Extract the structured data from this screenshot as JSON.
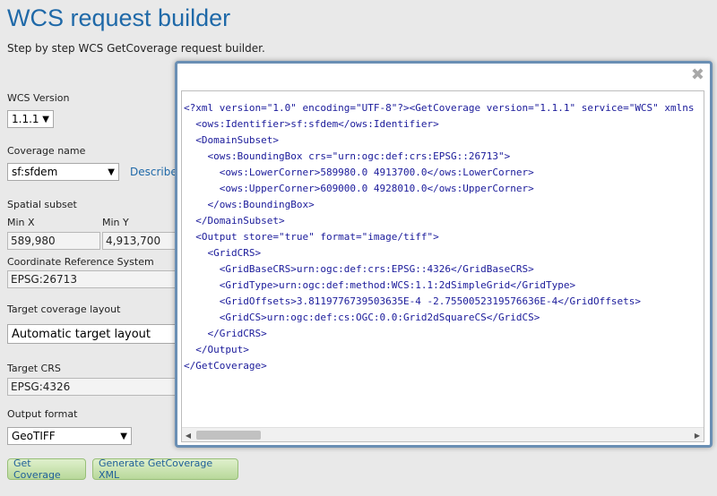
{
  "header": {
    "title": "WCS request builder",
    "subtitle": "Step by step WCS GetCoverage request builder."
  },
  "form": {
    "wcs_version_label": "WCS Version",
    "wcs_version_value": "1.1.1",
    "coverage_name_label": "Coverage name",
    "coverage_name_value": "sf:sfdem",
    "describe_link": "Describe",
    "spatial_subset_label": "Spatial subset",
    "min_x_label": "Min X",
    "min_x_value": "589,980",
    "min_y_label": "Min Y",
    "min_y_value": "4,913,700",
    "crs_label": "Coordinate Reference System",
    "crs_value": "EPSG:26713",
    "target_layout_label": "Target coverage layout",
    "target_layout_value": "Automatic target layout",
    "target_crs_label": "Target CRS",
    "target_crs_value": "EPSG:4326",
    "output_format_label": "Output format",
    "output_format_value": "GeoTIFF"
  },
  "buttons": {
    "get_coverage": "Get Coverage",
    "generate_xml": "Generate GetCoverage XML"
  },
  "modal": {
    "close_glyph": "✖",
    "xml_lines": [
      "<?xml version=\"1.0\" encoding=\"UTF-8\"?><GetCoverage version=\"1.1.1\" service=\"WCS\" xmlns",
      "  <ows:Identifier>sf:sfdem</ows:Identifier>",
      "  <DomainSubset>",
      "    <ows:BoundingBox crs=\"urn:ogc:def:crs:EPSG::26713\">",
      "      <ows:LowerCorner>589980.0 4913700.0</ows:LowerCorner>",
      "      <ows:UpperCorner>609000.0 4928010.0</ows:UpperCorner>",
      "    </ows:BoundingBox>",
      "  </DomainSubset>",
      "  <Output store=\"true\" format=\"image/tiff\">",
      "    <GridCRS>",
      "      <GridBaseCRS>urn:ogc:def:crs:EPSG::4326</GridBaseCRS>",
      "      <GridType>urn:ogc:def:method:WCS:1.1:2dSimpleGrid</GridType>",
      "      <GridOffsets>3.8119776739503635E-4 -2.7550052319576636E-4</GridOffsets>",
      "      <GridCS>urn:ogc:def:cs:OGC:0.0:Grid2dSquareCS</GridCS>",
      "    </GridCRS>",
      "  </Output>",
      "</GetCoverage>"
    ]
  },
  "icons": {
    "dropdown": "chevron-down-icon",
    "scroll_left": "arrow-left-icon",
    "scroll_right": "arrow-right-icon"
  }
}
